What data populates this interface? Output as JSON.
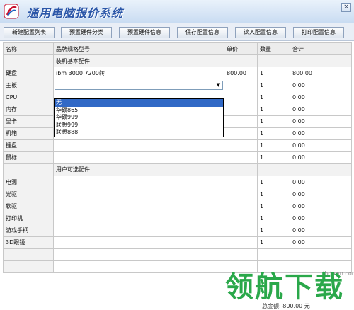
{
  "window": {
    "title": "通用电脑报价系统",
    "close_glyph": "×",
    "accent": "#2a56a8"
  },
  "toolbar": {
    "buttons": [
      "新建配置列表",
      "预置硬件分类",
      "预置硬件信息",
      "保存配置信息",
      "读入配置信息",
      "打印配置信息"
    ]
  },
  "grid": {
    "headers": [
      "名称",
      "品牌规格型号",
      "单价",
      "数量",
      "合计"
    ],
    "section_basic": "装机基本配件",
    "section_optional": "用户可选配件",
    "rows": [
      {
        "name": "硬盘",
        "model": "ibm 3000 7200转",
        "price": "800.00",
        "qty": "1",
        "total": "800.00"
      },
      {
        "name": "主板",
        "model": "",
        "price": "",
        "qty": "1",
        "total": "0.00"
      },
      {
        "name": "CPU",
        "model": "",
        "price": "",
        "qty": "1",
        "total": "0.00"
      },
      {
        "name": "内存",
        "model": "",
        "price": "",
        "qty": "1",
        "total": "0.00"
      },
      {
        "name": "显卡",
        "model": "",
        "price": "",
        "qty": "1",
        "total": "0.00"
      },
      {
        "name": "机箱",
        "model": "",
        "price": "",
        "qty": "1",
        "total": "0.00"
      },
      {
        "name": "键盘",
        "model": "",
        "price": "",
        "qty": "1",
        "total": "0.00"
      },
      {
        "name": "鼠标",
        "model": "",
        "price": "",
        "qty": "1",
        "total": "0.00"
      }
    ],
    "optional_rows": [
      {
        "name": "电源",
        "qty": "1",
        "total": "0.00"
      },
      {
        "name": "光驱",
        "qty": "1",
        "total": "0.00"
      },
      {
        "name": "软驱",
        "qty": "1",
        "total": "0.00"
      },
      {
        "name": "打印机",
        "qty": "1",
        "total": "0.00"
      },
      {
        "name": "游戏手柄",
        "qty": "1",
        "total": "0.00"
      },
      {
        "name": "3D眼镜",
        "qty": "1",
        "total": "0.00"
      }
    ]
  },
  "dropdown": {
    "options": [
      "无",
      "华硕865",
      "华硕999",
      "联想999",
      "联想888"
    ],
    "selected_index": 0
  },
  "footer": {
    "total_label": "总金额:",
    "total_value": "800.00",
    "total_unit": "元"
  },
  "watermark": {
    "logo_text": "领航下载",
    "url": "ihdown.com",
    "color": "#2aa84a"
  }
}
